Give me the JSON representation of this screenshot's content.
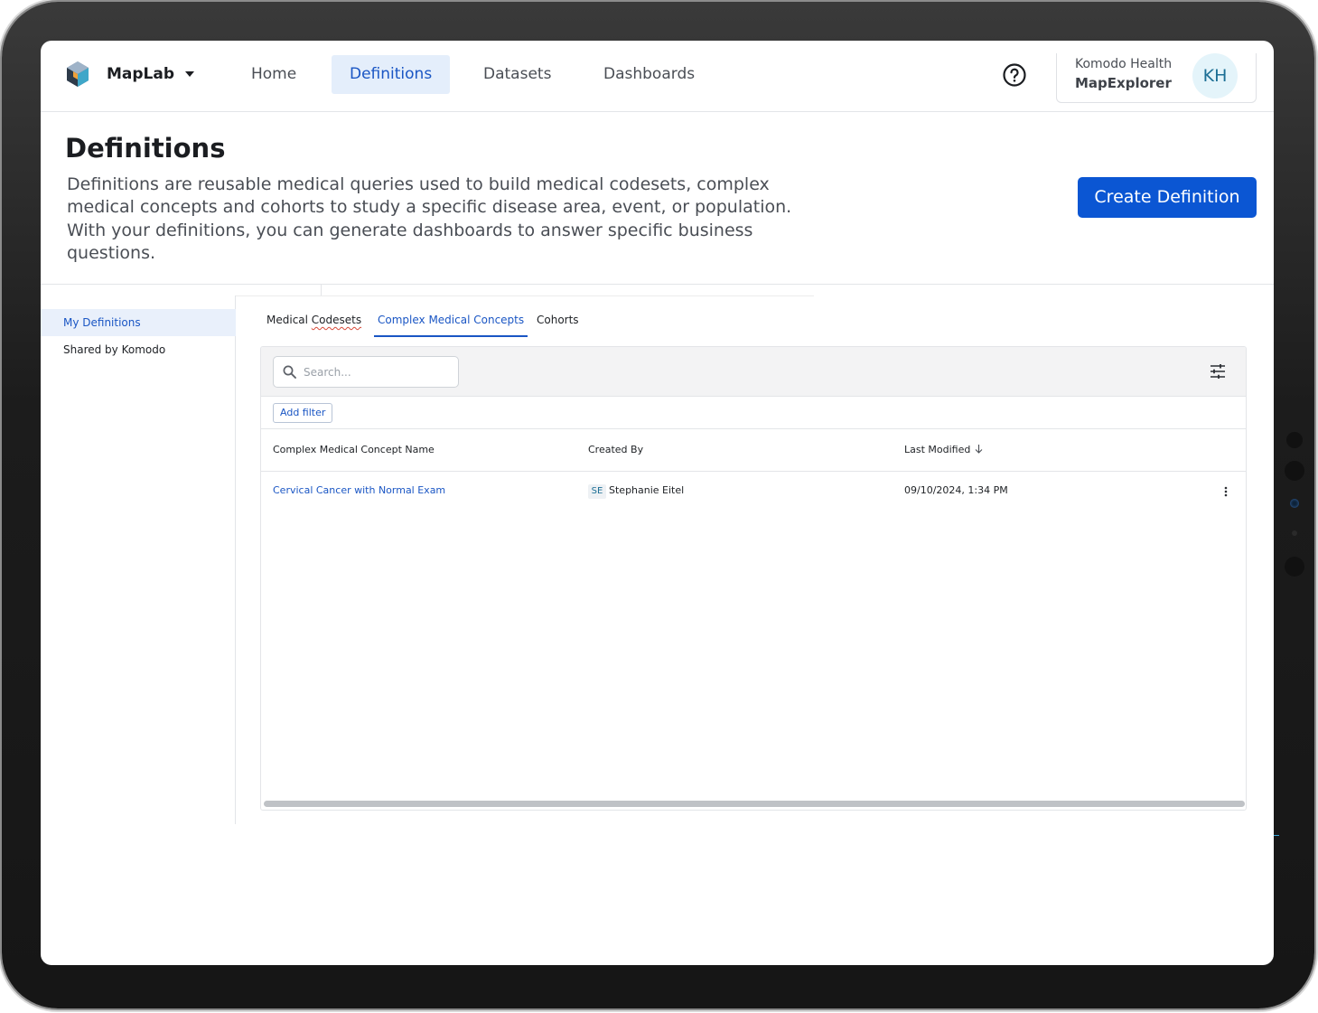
{
  "app": {
    "name": "MapLab",
    "account_org": "Komodo Health",
    "account_app": "MapExplorer",
    "avatar_initials": "KH",
    "accent_color": "#0b56d3"
  },
  "nav": {
    "items": [
      "Home",
      "Definitions",
      "Datasets",
      "Dashboards"
    ],
    "active": "Definitions"
  },
  "page": {
    "title": "Definitions",
    "description": "Definitions are reusable medical queries used to build medical codesets, complex medical concepts and cohorts to study a specific disease area, event, or population. With your definitions, you can generate dashboards to answer specific business questions.",
    "create_button": "Create Definition"
  },
  "sidebar": {
    "items": [
      "My Definitions",
      "Shared by Komodo"
    ],
    "active": "My Definitions"
  },
  "tabs": {
    "items": [
      "Medical Codesets",
      "Complex Medical Concepts",
      "Cohorts"
    ],
    "active": "Complex Medical Concepts"
  },
  "toolbar": {
    "search_placeholder": "Search...",
    "add_filter": "Add filter"
  },
  "table": {
    "columns": [
      "Complex Medical Concept Name",
      "Created By",
      "Last Modified"
    ],
    "sort_column": "Last Modified",
    "sort_direction": "descending",
    "rows": [
      {
        "name": "Cervical Cancer with Normal Exam",
        "created_by_initials": "SE",
        "created_by": "Stephanie Eitel",
        "last_modified": "09/10/2024, 1:34 PM"
      }
    ]
  }
}
